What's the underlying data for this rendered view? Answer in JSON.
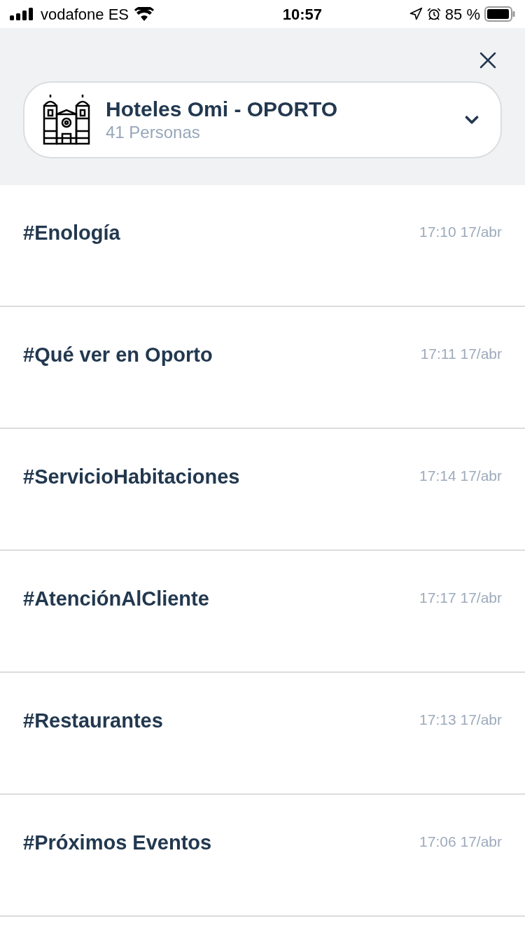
{
  "status_bar": {
    "carrier": "vodafone ES",
    "time": "10:57",
    "battery": "85 %"
  },
  "group": {
    "name": "Hoteles Omi - OPORTO",
    "members": "41 Personas"
  },
  "channels": [
    {
      "name": "#Enología",
      "time": "17:10 17/abr"
    },
    {
      "name": "#Qué ver en Oporto",
      "time": "17:11 17/abr"
    },
    {
      "name": "#ServicioHabitaciones",
      "time": "17:14 17/abr"
    },
    {
      "name": "#AtenciónAlCliente",
      "time": "17:17 17/abr"
    },
    {
      "name": "#Restaurantes",
      "time": "17:13 17/abr"
    },
    {
      "name": "#Próximos Eventos",
      "time": "17:06 17/abr"
    }
  ]
}
